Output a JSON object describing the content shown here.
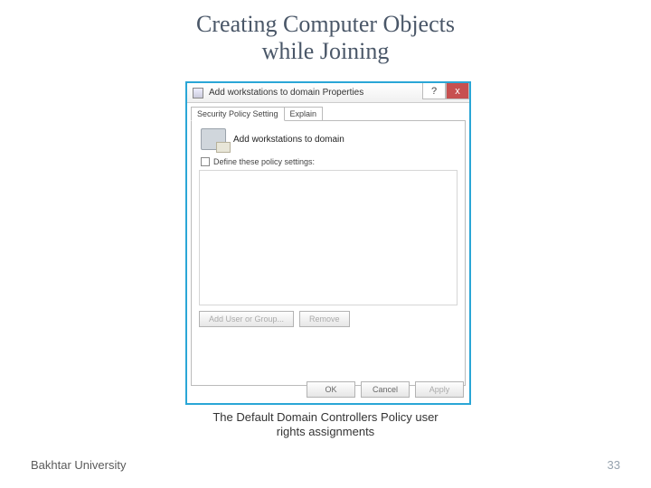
{
  "title_line1": "Creating Computer Objects",
  "title_line2": "while Joining",
  "dialog": {
    "title": "Add workstations to domain Properties",
    "help_glyph": "?",
    "close_glyph": "x",
    "tabs": {
      "security": "Security Policy Setting",
      "explain": "Explain"
    },
    "policy_name": "Add workstations to domain",
    "checkbox_label": "Define these policy settings:",
    "buttons": {
      "add": "Add User or Group...",
      "remove": "Remove",
      "ok": "OK",
      "cancel": "Cancel",
      "apply": "Apply"
    }
  },
  "caption_line1": "The Default Domain Controllers Policy user",
  "caption_line2": "rights assignments",
  "footer": {
    "left": "Bakhtar University",
    "page": "33"
  }
}
